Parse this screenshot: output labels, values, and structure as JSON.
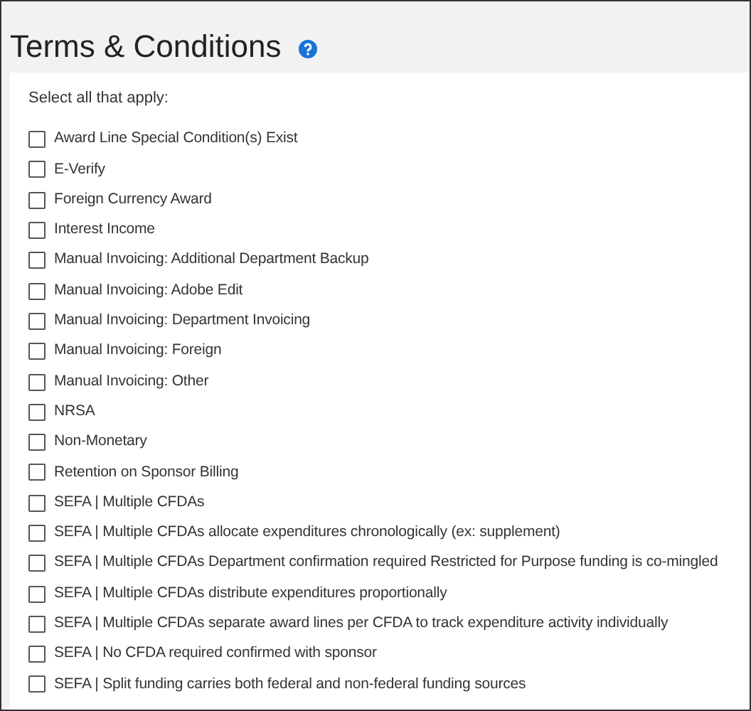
{
  "title": "Terms & Conditions",
  "instruction": "Select all that apply:",
  "options": [
    {
      "label": "Award Line Special Condition(s) Exist",
      "checked": false
    },
    {
      "label": "E-Verify",
      "checked": false
    },
    {
      "label": "Foreign Currency Award",
      "checked": false
    },
    {
      "label": "Interest Income",
      "checked": false
    },
    {
      "label": "Manual Invoicing: Additional Department Backup",
      "checked": false
    },
    {
      "label": "Manual Invoicing: Adobe Edit",
      "checked": false
    },
    {
      "label": "Manual Invoicing: Department Invoicing",
      "checked": false
    },
    {
      "label": "Manual Invoicing: Foreign",
      "checked": false
    },
    {
      "label": "Manual Invoicing: Other",
      "checked": false
    },
    {
      "label": "NRSA",
      "checked": false
    },
    {
      "label": "Non-Monetary",
      "checked": false
    },
    {
      "label": "Retention on Sponsor Billing",
      "checked": false
    },
    {
      "label": "SEFA | Multiple CFDAs",
      "checked": false
    },
    {
      "label": "SEFA | Multiple CFDAs allocate expenditures chronologically (ex: supplement)",
      "checked": false
    },
    {
      "label": "SEFA | Multiple CFDAs Department confirmation required Restricted for Purpose funding is co-mingled",
      "checked": false
    },
    {
      "label": "SEFA | Multiple CFDAs distribute expenditures proportionally",
      "checked": false
    },
    {
      "label": "SEFA | Multiple CFDAs separate award lines per CFDA to track expenditure activity individually",
      "checked": false
    },
    {
      "label": "SEFA | No CFDA required confirmed with sponsor",
      "checked": false
    },
    {
      "label": "SEFA | Split funding carries both federal and non-federal funding sources",
      "checked": false
    }
  ]
}
